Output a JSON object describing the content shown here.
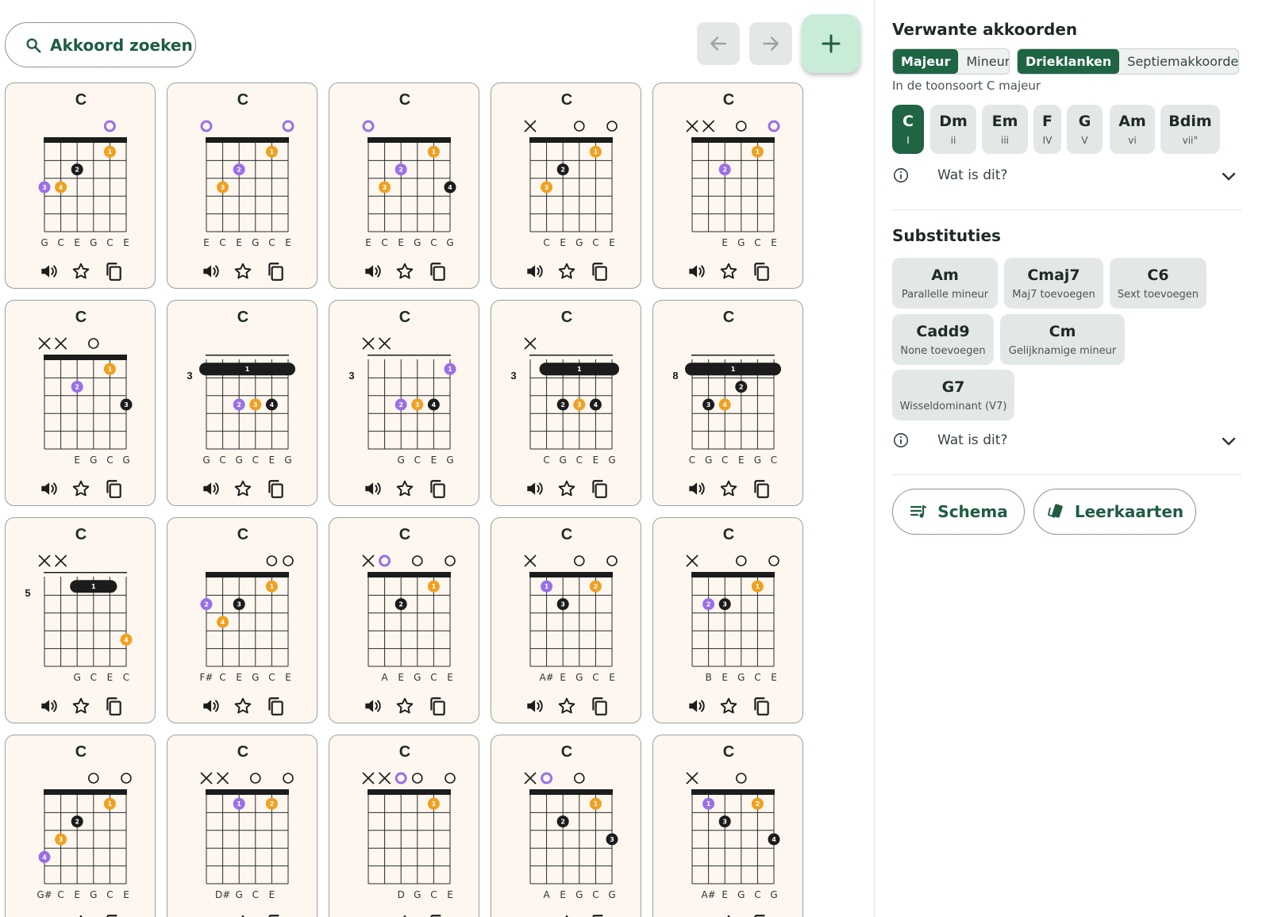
{
  "toolbar": {
    "search_label": "Akkoord zoeken",
    "search_icon": "search-icon",
    "back_icon": "arrow-left-icon",
    "forward_icon": "arrow-right-icon",
    "add_icon": "plus-icon"
  },
  "colors": {
    "finger_orange": "#f0a020",
    "finger_purple": "#9a6fe8",
    "finger_black": "#1c1c1c",
    "accent_green": "#1f6443"
  },
  "cards": [
    {
      "name": "C",
      "fret": "",
      "top": [
        "",
        "",
        "",
        "",
        "root",
        ""
      ],
      "strings": [
        "G",
        "C",
        "E",
        "G",
        "C",
        "E"
      ],
      "dots": [
        [
          4,
          1,
          "o",
          "1"
        ],
        [
          2,
          2,
          "k",
          "2"
        ],
        [
          0,
          3,
          "p",
          "3"
        ],
        [
          1,
          3,
          "o",
          "4"
        ]
      ]
    },
    {
      "name": "C",
      "fret": "",
      "top": [
        "root",
        "",
        "",
        "",
        "",
        "root"
      ],
      "strings": [
        "E",
        "C",
        "E",
        "G",
        "C",
        "E"
      ],
      "dots": [
        [
          4,
          1,
          "o",
          "1"
        ],
        [
          2,
          2,
          "p",
          "2"
        ],
        [
          1,
          3,
          "o",
          "3"
        ]
      ]
    },
    {
      "name": "C",
      "fret": "",
      "top": [
        "root",
        "",
        "",
        "",
        "",
        ""
      ],
      "strings": [
        "E",
        "C",
        "E",
        "G",
        "C",
        "G"
      ],
      "dots": [
        [
          4,
          1,
          "o",
          "1"
        ],
        [
          2,
          2,
          "p",
          "2"
        ],
        [
          1,
          3,
          "o",
          "3"
        ],
        [
          5,
          3,
          "k",
          "4"
        ]
      ]
    },
    {
      "name": "C",
      "fret": "",
      "top": [
        "x",
        "",
        "",
        "o",
        "",
        "o"
      ],
      "strings": [
        "",
        "C",
        "E",
        "G",
        "C",
        "E"
      ],
      "dots": [
        [
          4,
          1,
          "o",
          "1"
        ],
        [
          2,
          2,
          "k",
          "2"
        ],
        [
          1,
          3,
          "o",
          "3"
        ]
      ]
    },
    {
      "name": "C",
      "fret": "",
      "top": [
        "x",
        "x",
        "",
        "o",
        "",
        "root"
      ],
      "strings": [
        "",
        "",
        "E",
        "G",
        "C",
        "E"
      ],
      "dots": [
        [
          4,
          1,
          "o",
          "1"
        ],
        [
          2,
          2,
          "p",
          "2"
        ]
      ]
    },
    {
      "name": "C",
      "fret": "",
      "top": [
        "x",
        "x",
        "",
        "o",
        "",
        ""
      ],
      "strings": [
        "",
        "",
        "E",
        "G",
        "C",
        "G"
      ],
      "dots": [
        [
          4,
          1,
          "o",
          "1"
        ],
        [
          2,
          2,
          "p",
          "2"
        ],
        [
          5,
          3,
          "k",
          "3"
        ]
      ]
    },
    {
      "name": "C",
      "fret": "3",
      "top": [
        "",
        "",
        "",
        "",
        "",
        ""
      ],
      "strings": [
        "G",
        "C",
        "G",
        "C",
        "E",
        "G"
      ],
      "barre": [
        0,
        5,
        1,
        "1"
      ],
      "dots": [
        [
          2,
          3,
          "p",
          "2"
        ],
        [
          3,
          3,
          "o",
          "3"
        ],
        [
          4,
          3,
          "k",
          "4"
        ]
      ]
    },
    {
      "name": "C",
      "fret": "3",
      "top": [
        "x",
        "x",
        "",
        "",
        "",
        ""
      ],
      "strings": [
        "",
        "",
        "G",
        "C",
        "E",
        "G"
      ],
      "dots": [
        [
          5,
          1,
          "p",
          "1"
        ],
        [
          2,
          3,
          "p",
          "2"
        ],
        [
          3,
          3,
          "o",
          "3"
        ],
        [
          4,
          3,
          "k",
          "4"
        ]
      ]
    },
    {
      "name": "C",
      "fret": "3",
      "top": [
        "x",
        "",
        "",
        "",
        "",
        ""
      ],
      "strings": [
        "",
        "C",
        "G",
        "C",
        "E",
        "G"
      ],
      "barre": [
        1,
        5,
        1,
        "1"
      ],
      "dots": [
        [
          2,
          3,
          "k",
          "2"
        ],
        [
          3,
          3,
          "o",
          "3"
        ],
        [
          4,
          3,
          "k",
          "4"
        ]
      ]
    },
    {
      "name": "C",
      "fret": "8",
      "top": [
        "",
        "",
        "",
        "",
        "",
        ""
      ],
      "strings": [
        "C",
        "G",
        "C",
        "E",
        "G",
        "C"
      ],
      "barre": [
        0,
        5,
        1,
        "1"
      ],
      "dots": [
        [
          3,
          2,
          "k",
          "2"
        ],
        [
          1,
          3,
          "k",
          "3"
        ],
        [
          2,
          3,
          "o",
          "4"
        ]
      ]
    },
    {
      "name": "C",
      "fret": "5",
      "top": [
        "x",
        "x",
        "",
        "",
        "",
        ""
      ],
      "strings": [
        "",
        "",
        "G",
        "C",
        "E",
        "C"
      ],
      "barre": [
        2,
        4,
        1,
        "1"
      ],
      "dots": [
        [
          5,
          4,
          "o",
          "4"
        ]
      ]
    },
    {
      "name": "C",
      "fret": "",
      "top": [
        "",
        "",
        "",
        "",
        "o",
        "o"
      ],
      "strings": [
        "F#",
        "C",
        "E",
        "G",
        "C",
        "E"
      ],
      "dots": [
        [
          4,
          1,
          "o",
          "1"
        ],
        [
          0,
          2,
          "p",
          "2"
        ],
        [
          2,
          2,
          "k",
          "3"
        ],
        [
          1,
          3,
          "o",
          "4"
        ]
      ]
    },
    {
      "name": "C",
      "fret": "",
      "top": [
        "x",
        "root",
        "",
        "o",
        "",
        "o"
      ],
      "strings": [
        "",
        "A",
        "E",
        "G",
        "C",
        "E"
      ],
      "dots": [
        [
          4,
          1,
          "o",
          "1"
        ],
        [
          2,
          2,
          "k",
          "2"
        ]
      ]
    },
    {
      "name": "C",
      "fret": "",
      "top": [
        "x",
        "",
        "",
        "o",
        "",
        "o"
      ],
      "strings": [
        "",
        "A#",
        "E",
        "G",
        "C",
        "E"
      ],
      "dots": [
        [
          1,
          1,
          "p",
          "1"
        ],
        [
          4,
          1,
          "o",
          "2"
        ],
        [
          2,
          2,
          "k",
          "3"
        ]
      ]
    },
    {
      "name": "C",
      "fret": "",
      "top": [
        "x",
        "",
        "",
        "o",
        "",
        "o"
      ],
      "strings": [
        "",
        "B",
        "E",
        "G",
        "C",
        "E"
      ],
      "dots": [
        [
          4,
          1,
          "o",
          "1"
        ],
        [
          1,
          2,
          "p",
          "2"
        ],
        [
          2,
          2,
          "k",
          "3"
        ]
      ]
    },
    {
      "name": "C",
      "fret": "",
      "top": [
        "",
        "",
        "",
        "o",
        "",
        "o"
      ],
      "strings": [
        "G#",
        "C",
        "E",
        "G",
        "C",
        "E"
      ],
      "dots": [
        [
          4,
          1,
          "o",
          "1"
        ],
        [
          2,
          2,
          "k",
          "2"
        ],
        [
          1,
          3,
          "o",
          "3"
        ],
        [
          0,
          4,
          "p",
          "4"
        ]
      ]
    },
    {
      "name": "C",
      "fret": "",
      "top": [
        "x",
        "x",
        "",
        "o",
        "",
        "o"
      ],
      "strings": [
        "",
        "D#",
        "G",
        "C",
        "E",
        ""
      ],
      "dots": [
        [
          2,
          1,
          "p",
          "1"
        ],
        [
          4,
          1,
          "o",
          "2"
        ]
      ]
    },
    {
      "name": "C",
      "fret": "",
      "top": [
        "x",
        "x",
        "root",
        "o",
        "",
        "o"
      ],
      "strings": [
        "",
        "",
        "D",
        "G",
        "C",
        "E"
      ],
      "dots": [
        [
          4,
          1,
          "o",
          "1"
        ]
      ]
    },
    {
      "name": "C",
      "fret": "",
      "top": [
        "x",
        "root",
        "",
        "o",
        "",
        ""
      ],
      "strings": [
        "",
        "A",
        "E",
        "G",
        "C",
        "G"
      ],
      "dots": [
        [
          4,
          1,
          "o",
          "1"
        ],
        [
          2,
          2,
          "k",
          "2"
        ],
        [
          5,
          3,
          "k",
          "3"
        ]
      ]
    },
    {
      "name": "C",
      "fret": "",
      "top": [
        "x",
        "",
        "",
        "o",
        "",
        ""
      ],
      "strings": [
        "",
        "A#",
        "E",
        "G",
        "C",
        "G"
      ],
      "dots": [
        [
          1,
          1,
          "p",
          "1"
        ],
        [
          4,
          1,
          "o",
          "2"
        ],
        [
          2,
          2,
          "k",
          "3"
        ],
        [
          5,
          3,
          "k",
          "4"
        ]
      ]
    }
  ],
  "card_actions": {
    "play_icon": "speaker-icon",
    "fav_icon": "star-icon",
    "copy_icon": "copy-icon"
  },
  "related": {
    "title": "Verwante akkoorden",
    "mode_options": [
      "Majeur",
      "Mineur"
    ],
    "mode_selected": "Majeur",
    "type_options": [
      "Drieklanken",
      "Septiemakkoorden"
    ],
    "type_selected": "Drieklanken",
    "key_text": "In de toonsoort C majeur",
    "degrees": [
      {
        "name": "C",
        "roman": "I"
      },
      {
        "name": "Dm",
        "roman": "ii"
      },
      {
        "name": "Em",
        "roman": "iii"
      },
      {
        "name": "F",
        "roman": "IV"
      },
      {
        "name": "G",
        "roman": "V"
      },
      {
        "name": "Am",
        "roman": "vi"
      },
      {
        "name": "Bdim",
        "roman": "vii°"
      }
    ],
    "info_label": "Wat is dit?"
  },
  "substitutions": {
    "title": "Substituties",
    "items": [
      {
        "name": "Am",
        "desc": "Parallelle mineur"
      },
      {
        "name": "Cmaj7",
        "desc": "Maj7 toevoegen"
      },
      {
        "name": "C6",
        "desc": "Sext toevoegen"
      },
      {
        "name": "Cadd9",
        "desc": "None toevoegen"
      },
      {
        "name": "Cm",
        "desc": "Gelijknamige mineur"
      },
      {
        "name": "G7",
        "desc": "Wisseldominant (V7)"
      }
    ],
    "info_label": "Wat is dit?"
  },
  "bottom_buttons": {
    "schema": "Schema",
    "flashcards": "Leerkaarten"
  }
}
